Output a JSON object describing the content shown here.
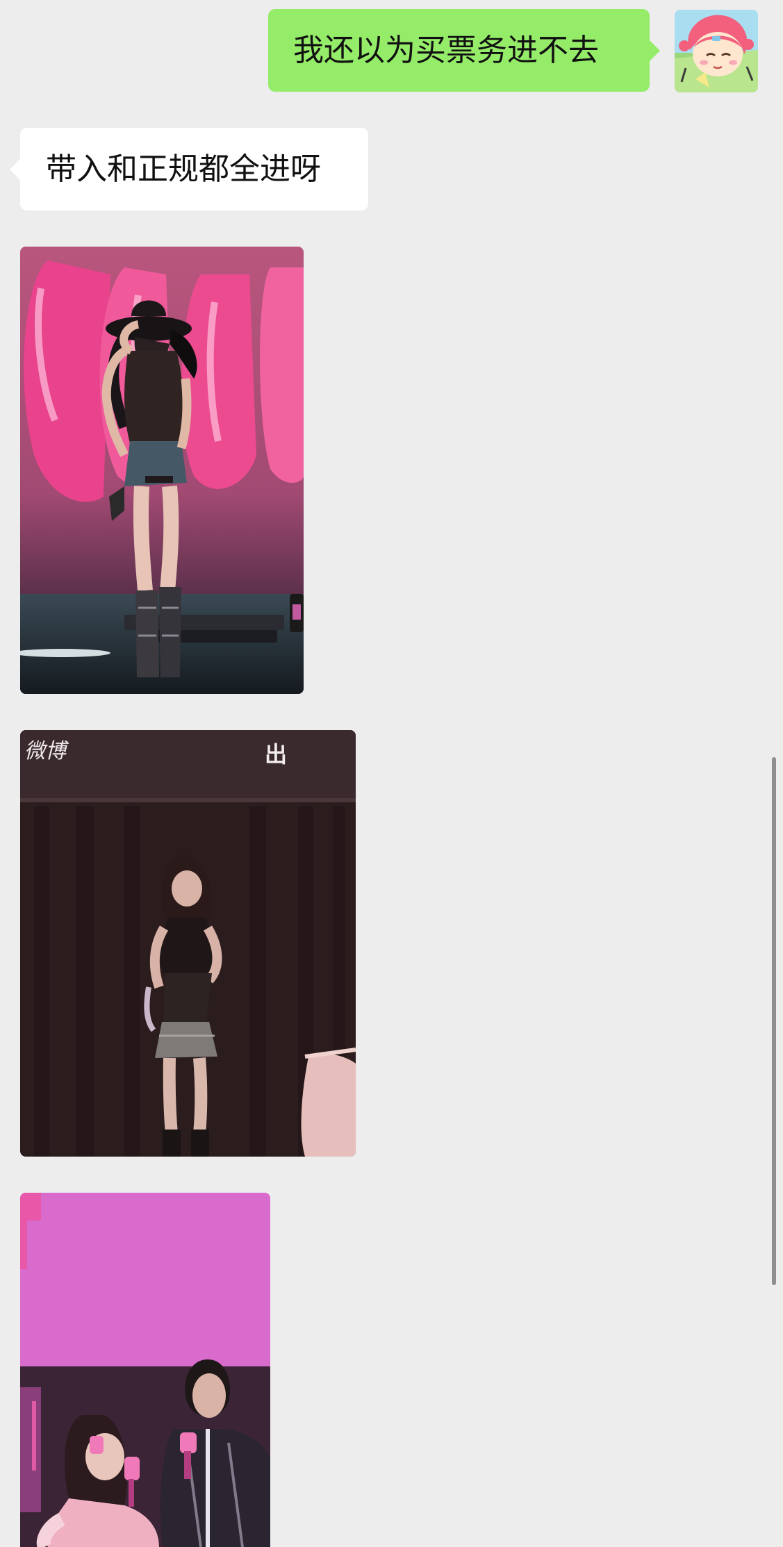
{
  "chat": {
    "messages": [
      {
        "direction": "outgoing",
        "type": "text",
        "text": "我还以为买票务进不去"
      },
      {
        "direction": "incoming",
        "type": "text",
        "text": "带入和正规都全进呀"
      },
      {
        "direction": "incoming",
        "type": "image",
        "image": "performer-in-black-cowboy-hat-on-pink-stage"
      },
      {
        "direction": "incoming",
        "type": "image",
        "image": "performer-in-black-top-and-sequin-skirt-in-front-of-curtain",
        "overlay_texts": [
          "微博",
          "出"
        ]
      },
      {
        "direction": "incoming",
        "type": "image",
        "image": "performer-and-host-with-microphones-on-pink-stage"
      }
    ]
  },
  "colors": {
    "background": "#ededed",
    "outgoing_bubble": "#95ec69",
    "incoming_bubble": "#ffffff",
    "text": "#111111",
    "scrollbar": "#8e8e8e"
  },
  "icons": {
    "avatar": "cartoon-girl-avatar-icon"
  }
}
